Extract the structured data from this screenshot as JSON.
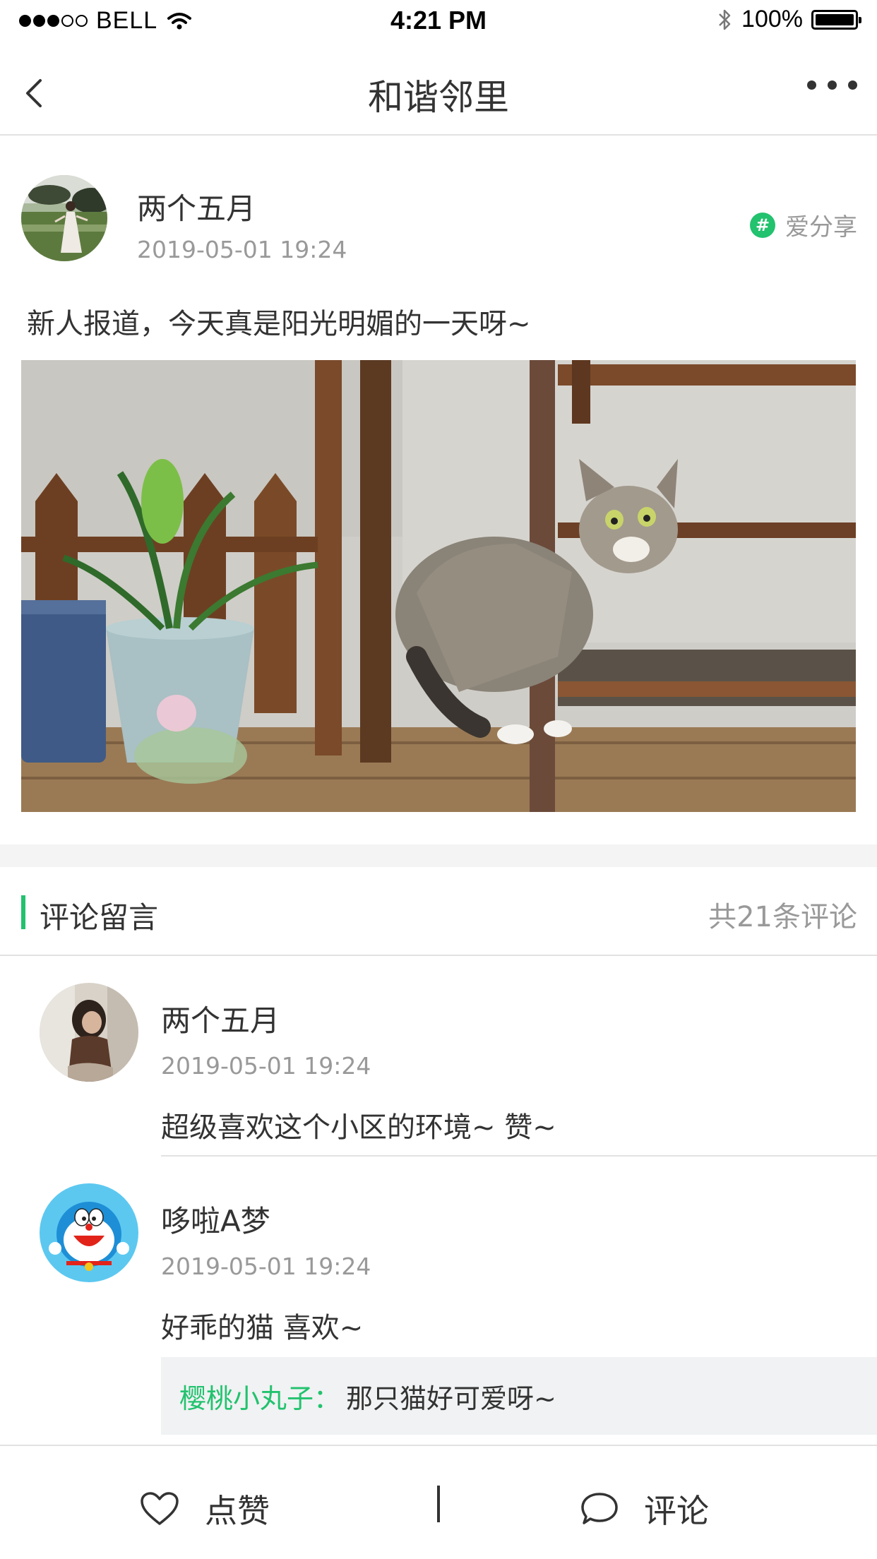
{
  "status_bar": {
    "carrier": "BELL",
    "time": "4:21 PM",
    "battery": "100%",
    "signal_bars": 3,
    "icons": [
      "wifi-icon",
      "bluetooth-icon",
      "battery-icon"
    ]
  },
  "nav": {
    "title": "和谐邻里",
    "icons": [
      "back-chevron-icon",
      "more-dots-icon"
    ]
  },
  "post": {
    "author": "两个五月",
    "time": "2019-05-01  19:24",
    "tag": "爱分享",
    "text": "新人报道，今天真是阳光明媚的一天呀~"
  },
  "comments_section": {
    "title": "评论留言",
    "count": "共21条评论"
  },
  "comments": [
    {
      "author": "两个五月",
      "time": "2019-05-01  19:24",
      "text": "超级喜欢这个小区的环境~  赞~"
    },
    {
      "author": "哆啦A梦",
      "time": "2019-05-01  19:24",
      "text": "好乖的猫 喜欢~",
      "reply": {
        "author": "樱桃小丸子：",
        "text": "那只猫好可爱呀~"
      }
    }
  ],
  "bottom_bar": {
    "like_label": "点赞",
    "comment_label": "评论"
  },
  "colors": {
    "accent": "#22c26e",
    "text": "#333333",
    "muted": "#999999",
    "divider": "#e2e2e2"
  }
}
